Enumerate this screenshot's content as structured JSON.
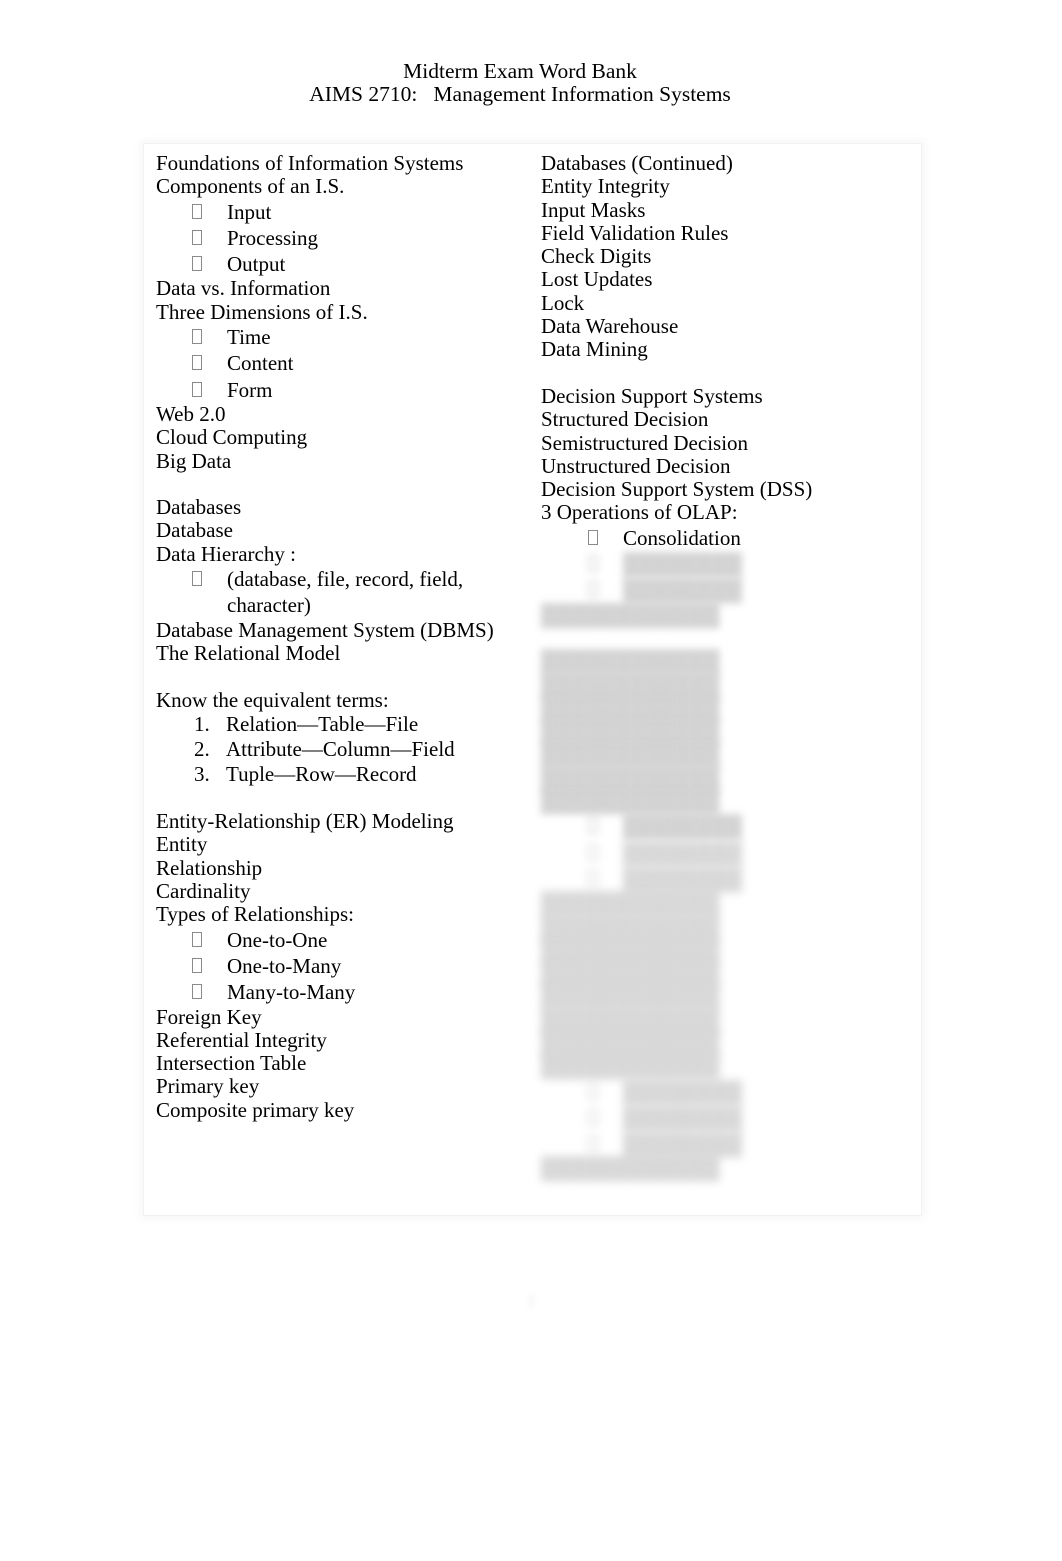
{
  "document": {
    "header": {
      "title_line_1": "Midterm Exam Word Bank",
      "title_line_2": "AIMS 2710:   Management Information Systems"
    },
    "page_number": "1",
    "bullet_glyph_name": "missing-glyph-box-bullet"
  },
  "left_column": {
    "items": [
      {
        "type": "text",
        "text": "Foundations of Information Systems"
      },
      {
        "type": "text",
        "text": "Components of an I.S."
      },
      {
        "type": "bullet",
        "text": "Input"
      },
      {
        "type": "bullet",
        "text": "Processing"
      },
      {
        "type": "bullet",
        "text": "Output"
      },
      {
        "type": "text",
        "text": "Data vs. Information"
      },
      {
        "type": "text",
        "text": "Three Dimensions of I.S."
      },
      {
        "type": "bullet",
        "text": "Time"
      },
      {
        "type": "bullet",
        "text": "Content"
      },
      {
        "type": "bullet",
        "text": "Form"
      },
      {
        "type": "text",
        "text": "Web 2.0"
      },
      {
        "type": "text",
        "text": "Cloud Computing"
      },
      {
        "type": "text",
        "text": "Big Data"
      },
      {
        "type": "blank",
        "text": ""
      },
      {
        "type": "text",
        "text": "Databases"
      },
      {
        "type": "text",
        "text": "Database"
      },
      {
        "type": "text",
        "text": "Data Hierarchy :"
      },
      {
        "type": "bullet",
        "text": "(database, file, record, field, character)"
      },
      {
        "type": "text",
        "text": "Database Management System (DBMS)"
      },
      {
        "type": "text",
        "text": "The Relational Model"
      },
      {
        "type": "blank",
        "text": ""
      },
      {
        "type": "text",
        "text": "Know the equivalent terms:"
      },
      {
        "type": "number",
        "marker": "1.",
        "text": "Relation—Table—File"
      },
      {
        "type": "number",
        "marker": "2.",
        "text": "Attribute—Column—Field"
      },
      {
        "type": "number",
        "marker": "3.",
        "text": "Tuple—Row—Record"
      },
      {
        "type": "blank",
        "text": ""
      },
      {
        "type": "text",
        "text": "Entity-Relationship (ER) Modeling"
      },
      {
        "type": "text",
        "text": "Entity"
      },
      {
        "type": "text",
        "text": "Relationship"
      },
      {
        "type": "text",
        "text": "Cardinality"
      },
      {
        "type": "text",
        "text": "Types of Relationships:"
      },
      {
        "type": "bullet",
        "text": "One-to-One"
      },
      {
        "type": "bullet",
        "text": "One-to-Many"
      },
      {
        "type": "bullet",
        "text": "Many-to-Many"
      },
      {
        "type": "text",
        "text": "Foreign Key"
      },
      {
        "type": "text",
        "text": "Referential Integrity"
      },
      {
        "type": "text",
        "text": "Intersection Table"
      },
      {
        "type": "text",
        "text": "Primary key"
      },
      {
        "type": "text",
        "text": "Composite primary key"
      }
    ]
  },
  "right_column": {
    "items": [
      {
        "type": "text",
        "text": "Databases (Continued)"
      },
      {
        "type": "text",
        "text": "Entity Integrity"
      },
      {
        "type": "text",
        "text": "Input Masks"
      },
      {
        "type": "text",
        "text": "Field Validation Rules"
      },
      {
        "type": "text",
        "text": "Check Digits"
      },
      {
        "type": "text",
        "text": "Lost Updates"
      },
      {
        "type": "text",
        "text": "Lock"
      },
      {
        "type": "text",
        "text": "Data Warehouse"
      },
      {
        "type": "text",
        "text": "Data Mining"
      },
      {
        "type": "blank",
        "text": ""
      },
      {
        "type": "text",
        "text": "Decision Support Systems"
      },
      {
        "type": "text",
        "text": "Structured Decision"
      },
      {
        "type": "text",
        "text": "Semistructured Decision"
      },
      {
        "type": "text",
        "text": "Unstructured Decision"
      },
      {
        "type": "text",
        "text": "Decision Support System (DSS)"
      },
      {
        "type": "text",
        "text": "3 Operations of OLAP:"
      },
      {
        "type": "bullet",
        "text": "Consolidation"
      },
      {
        "type": "bullet",
        "text": "",
        "redacted": true
      },
      {
        "type": "bullet",
        "text": "",
        "redacted": true
      },
      {
        "type": "text",
        "text": "",
        "redacted": true
      },
      {
        "type": "blank",
        "text": ""
      },
      {
        "type": "text",
        "text": "",
        "redacted": true
      },
      {
        "type": "text",
        "text": "",
        "redacted": true
      },
      {
        "type": "text",
        "text": "",
        "redacted": true
      },
      {
        "type": "text",
        "text": "",
        "redacted": true
      },
      {
        "type": "text",
        "text": "",
        "redacted": true
      },
      {
        "type": "text",
        "text": "",
        "redacted": true
      },
      {
        "type": "text",
        "text": "",
        "redacted": true
      },
      {
        "type": "bullet",
        "text": "",
        "redacted": true
      },
      {
        "type": "bullet",
        "text": "",
        "redacted": true
      },
      {
        "type": "bullet",
        "text": "",
        "redacted": true
      },
      {
        "type": "text",
        "text": "",
        "redacted": true
      },
      {
        "type": "text",
        "text": "",
        "redacted": true
      },
      {
        "type": "text",
        "text": "",
        "redacted": true
      },
      {
        "type": "text",
        "text": "",
        "redacted": true
      },
      {
        "type": "text",
        "text": "",
        "redacted": true
      },
      {
        "type": "text",
        "text": "",
        "redacted": true
      },
      {
        "type": "text",
        "text": "",
        "redacted": true
      },
      {
        "type": "text",
        "text": "",
        "redacted": true
      },
      {
        "type": "bullet",
        "text": "",
        "redacted": true
      },
      {
        "type": "bullet",
        "text": "",
        "redacted": true
      },
      {
        "type": "bullet",
        "text": "",
        "redacted": true
      },
      {
        "type": "text",
        "text": "",
        "redacted": true
      }
    ]
  }
}
